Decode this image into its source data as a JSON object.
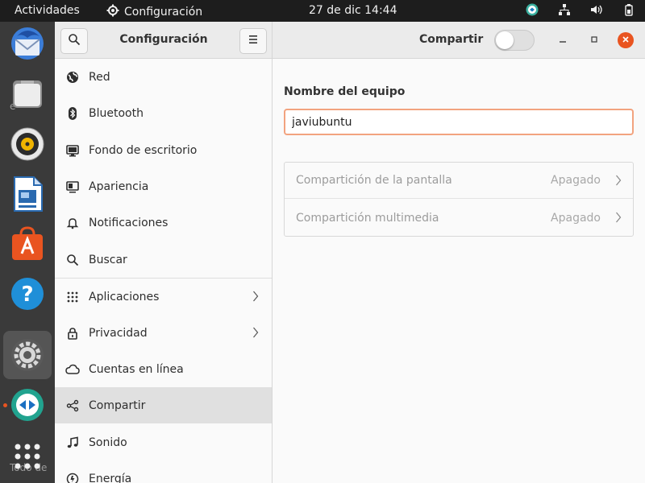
{
  "topbar": {
    "activities": "Actividades",
    "app_name": "Configuración",
    "clock": "27 de dic  14:44"
  },
  "dock": {
    "items": [
      "thunderbird-icon",
      "files-icon",
      "rhythmbox-icon",
      "libreoffice-impress-icon",
      "software-icon",
      "help-icon",
      "settings-icon",
      "teamviewer-icon",
      "show-apps-icon"
    ],
    "ghost_texts": [
      "e",
      "Todo de"
    ]
  },
  "sidebar": {
    "title": "Configuración",
    "items": [
      {
        "label": "Red",
        "icon": "network-icon"
      },
      {
        "label": "Bluetooth",
        "icon": "bluetooth-icon"
      },
      {
        "label": "Fondo de escritorio",
        "icon": "background-icon"
      },
      {
        "label": "Apariencia",
        "icon": "appearance-icon"
      },
      {
        "label": "Notificaciones",
        "icon": "bell-icon"
      },
      {
        "label": "Buscar",
        "icon": "search-icon"
      },
      {
        "label": "Aplicaciones",
        "icon": "apps-grid-icon"
      },
      {
        "label": "Privacidad",
        "icon": "lock-icon"
      },
      {
        "label": "Cuentas en línea",
        "icon": "cloud-icon"
      },
      {
        "label": "Compartir",
        "icon": "share-icon"
      },
      {
        "label": "Sonido",
        "icon": "music-note-icon"
      },
      {
        "label": "Energía",
        "icon": "power-icon"
      }
    ],
    "selected": "Compartir"
  },
  "main": {
    "title": "Compartir",
    "sharing_enabled": false,
    "device_name_label": "Nombre del equipo",
    "device_name_value": "javiubuntu",
    "rows": [
      {
        "label": "Compartición de la pantalla",
        "status": "Apagado"
      },
      {
        "label": "Compartición multimedia",
        "status": "Apagado"
      }
    ]
  },
  "colors": {
    "accent": "#e95420",
    "topbar": "#1d1d1d",
    "dock": "#3a3a3a",
    "selected_row": "#e0e0e0"
  }
}
